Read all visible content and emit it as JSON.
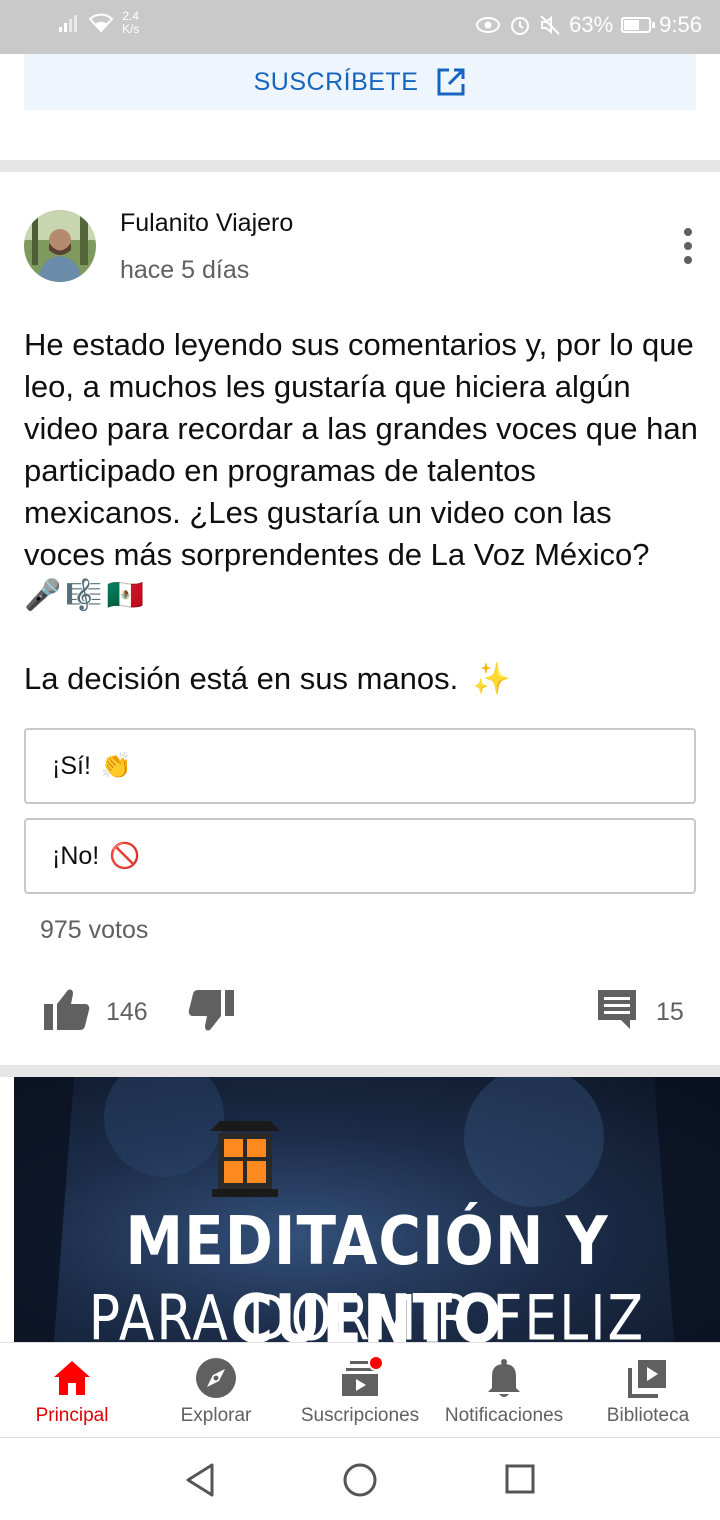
{
  "status_bar": {
    "net_speed": "2.4",
    "net_unit": "K/s",
    "battery": "63%",
    "battery_level": 0.63,
    "time": "9:56"
  },
  "subscribe_banner": {
    "label": "SUSCRÍBETE"
  },
  "post": {
    "author": "Fulanito Viajero",
    "time_ago": "hace 5 días",
    "body": "He estado leyendo sus comentarios y, por lo que leo, a muchos les gustaría que hiciera algún video para recordar a las grandes voces que han participado en programas de talentos mexicanos. ¿Les gustaría un video con las voces más sorprendentes de La Voz México?",
    "emojis": [
      "🎤",
      "🎼",
      "🇲🇽"
    ],
    "closing": "La decisión está en sus manos.",
    "closing_emoji": "✨",
    "poll": {
      "options": [
        {
          "label": "¡Sí!",
          "emoji": "👏"
        },
        {
          "label": "¡No!",
          "emoji": "🚫"
        }
      ],
      "votes": "975 votos"
    },
    "likes": "146",
    "comments": "15"
  },
  "thumbnail": {
    "title_line1": "MEDITACIÓN  Y CUENTO",
    "title_line2": "PARA DORMIR FELIZ"
  },
  "bottom_nav": {
    "items": [
      {
        "label": "Principal",
        "icon": "home-icon",
        "active": true
      },
      {
        "label": "Explorar",
        "icon": "compass-icon"
      },
      {
        "label": "Suscripciones",
        "icon": "subscriptions-icon"
      },
      {
        "label": "Notificaciones",
        "icon": "bell-icon"
      },
      {
        "label": "Biblioteca",
        "icon": "library-icon"
      }
    ]
  },
  "colors": {
    "accent_red": "#ff0000",
    "link_blue": "#1565c0",
    "text_secondary": "#606060"
  }
}
